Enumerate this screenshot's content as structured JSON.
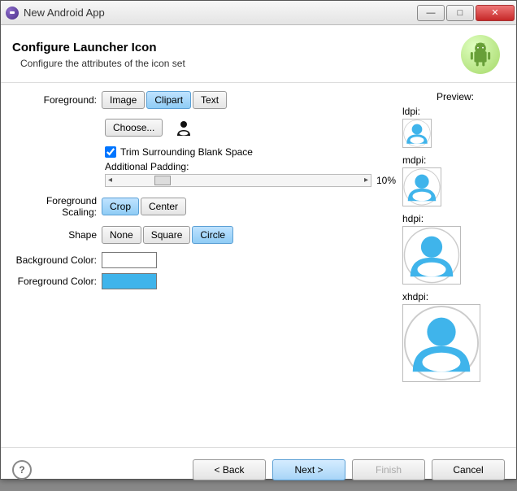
{
  "window": {
    "title": "New Android App"
  },
  "header": {
    "title": "Configure Launcher Icon",
    "subtitle": "Configure the attributes of the icon set"
  },
  "form": {
    "foreground_label": "Foreground:",
    "foreground_options": {
      "image": "Image",
      "clipart": "Clipart",
      "text": "Text"
    },
    "choose_label": "Choose...",
    "trim_label": "Trim Surrounding Blank Space",
    "trim_checked": true,
    "padding_label": "Additional Padding:",
    "padding_value": "10%",
    "scaling_label": "Foreground Scaling:",
    "scaling_options": {
      "crop": "Crop",
      "center": "Center"
    },
    "shape_label": "Shape",
    "shape_options": {
      "none": "None",
      "square": "Square",
      "circle": "Circle"
    },
    "bgcolor_label": "Background Color:",
    "fgcolor_label": "Foreground Color:",
    "bgcolor": "#ffffff",
    "fgcolor": "#3fb4eb"
  },
  "preview": {
    "title": "Preview:",
    "slots": {
      "ldpi": "ldpi:",
      "mdpi": "mdpi:",
      "hdpi": "hdpi:",
      "xhdpi": "xhdpi:"
    }
  },
  "footer": {
    "back": "< Back",
    "next": "Next >",
    "finish": "Finish",
    "cancel": "Cancel"
  }
}
